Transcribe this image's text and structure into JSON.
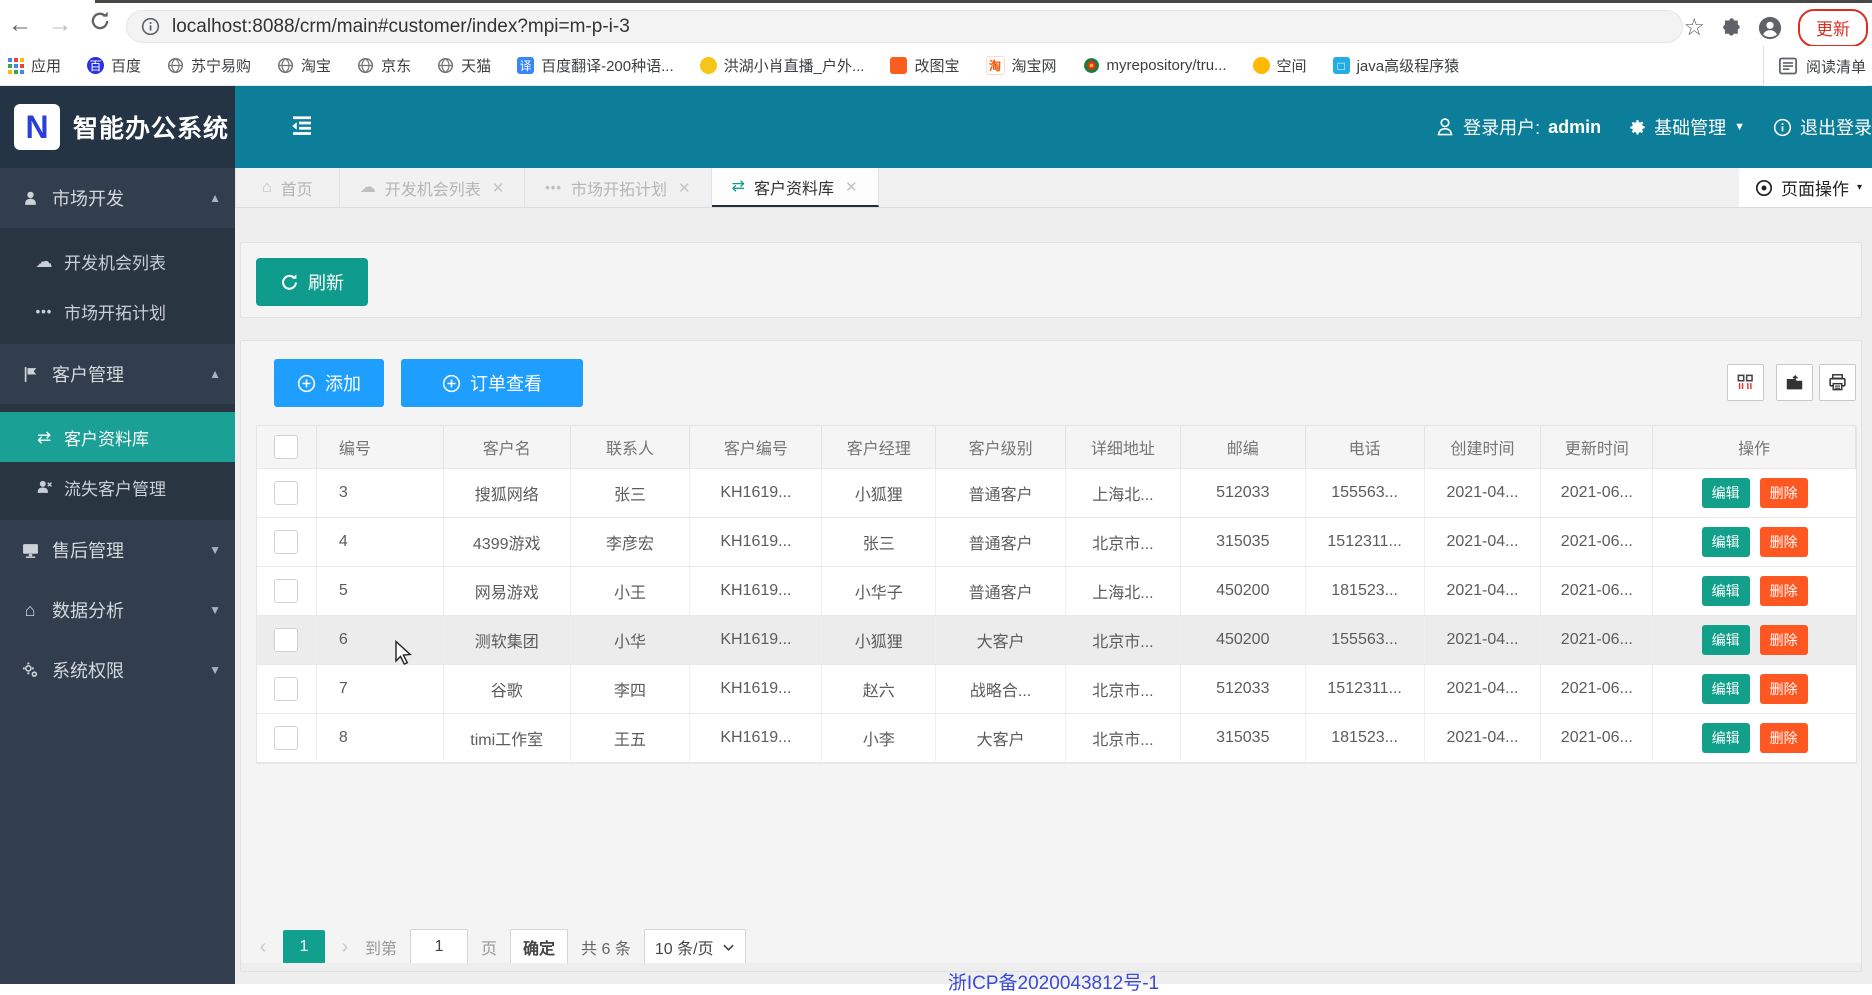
{
  "browser": {
    "url": "localhost:8088/crm/main#customer/index?mpi=m-p-i-3",
    "update_label": "更新",
    "bookmarks": [
      {
        "label": "应用",
        "icon": "apps-grid"
      },
      {
        "label": "百度",
        "icon": "baidu"
      },
      {
        "label": "苏宁易购",
        "icon": "globe"
      },
      {
        "label": "淘宝",
        "icon": "globe"
      },
      {
        "label": "京东",
        "icon": "globe"
      },
      {
        "label": "天猫",
        "icon": "globe"
      },
      {
        "label": "百度翻译-200种语...",
        "icon": "translate"
      },
      {
        "label": "洪湖小肖直播_户外...",
        "icon": "live"
      },
      {
        "label": "改图宝",
        "icon": "gaitubao"
      },
      {
        "label": "淘宝网",
        "icon": "taobao"
      },
      {
        "label": "myrepository/tru...",
        "icon": "repo"
      },
      {
        "label": "空间",
        "icon": "qzone"
      },
      {
        "label": "java高级程序猿",
        "icon": "bilibili"
      }
    ],
    "reading_list_label": "阅读清单"
  },
  "header": {
    "logo_letter": "N",
    "logo_title": "智能办公系统",
    "user_label": "登录用户:",
    "user_name": "admin",
    "base_mgmt_label": "基础管理",
    "logout_label": "退出登录"
  },
  "sidebar": {
    "groups": [
      {
        "label": "市场开发",
        "icon": "person",
        "expanded": true,
        "items": [
          {
            "label": "开发机会列表",
            "icon": "cloud"
          },
          {
            "label": "市场开拓计划",
            "icon": "dots"
          }
        ]
      },
      {
        "label": "客户管理",
        "icon": "flag",
        "expanded": true,
        "items": [
          {
            "label": "客户资料库",
            "icon": "exchange",
            "active": true
          },
          {
            "label": "流失客户管理",
            "icon": "user-x"
          }
        ]
      },
      {
        "label": "售后管理",
        "icon": "monitor",
        "expanded": false,
        "items": []
      },
      {
        "label": "数据分析",
        "icon": "home",
        "expanded": false,
        "items": []
      },
      {
        "label": "系统权限",
        "icon": "gears",
        "expanded": false,
        "items": []
      }
    ]
  },
  "tabs": [
    {
      "label": "首页",
      "icon": "home",
      "closable": false,
      "active": false
    },
    {
      "label": "开发机会列表",
      "icon": "cloud",
      "closable": true,
      "active": false
    },
    {
      "label": "市场开拓计划",
      "icon": "dots",
      "closable": true,
      "active": false
    },
    {
      "label": "客户资料库",
      "icon": "exchange",
      "closable": true,
      "active": true
    }
  ],
  "page_ops_label": "页面操作",
  "toolbar": {
    "refresh_label": "刷新",
    "add_label": "添加",
    "order_view_label": "订单查看",
    "icon_buttons": [
      "filter-columns",
      "export",
      "print"
    ]
  },
  "table": {
    "columns": [
      "编号",
      "客户名",
      "联系人",
      "客户编号",
      "客户经理",
      "客户级别",
      "详细地址",
      "邮编",
      "电话",
      "创建时间",
      "更新时间",
      "操作"
    ],
    "action_labels": {
      "edit": "编辑",
      "delete": "删除"
    },
    "rows": [
      {
        "cells": [
          "3",
          "搜狐网络",
          "张三",
          "KH1619...",
          "小狐狸",
          "普通客户",
          "上海北...",
          "512033",
          "155563...",
          "2021-04...",
          "2021-06..."
        ],
        "hover": false
      },
      {
        "cells": [
          "4",
          "4399游戏",
          "李彦宏",
          "KH1619...",
          "张三",
          "普通客户",
          "北京市...",
          "315035",
          "1512311...",
          "2021-04...",
          "2021-06..."
        ],
        "hover": false
      },
      {
        "cells": [
          "5",
          "网易游戏",
          "小王",
          "KH1619...",
          "小华子",
          "普通客户",
          "上海北...",
          "450200",
          "181523...",
          "2021-04...",
          "2021-06..."
        ],
        "hover": false
      },
      {
        "cells": [
          "6",
          "测软集团",
          "小华",
          "KH1619...",
          "小狐狸",
          "大客户",
          "北京市...",
          "450200",
          "155563...",
          "2021-04...",
          "2021-06..."
        ],
        "hover": true
      },
      {
        "cells": [
          "7",
          "谷歌",
          "李四",
          "KH1619...",
          "赵六",
          "战略合...",
          "北京市...",
          "512033",
          "1512311...",
          "2021-04...",
          "2021-06..."
        ],
        "hover": false
      },
      {
        "cells": [
          "8",
          "timi工作室",
          "王五",
          "KH1619...",
          "小李",
          "大客户",
          "北京市...",
          "315035",
          "181523...",
          "2021-04...",
          "2021-06..."
        ],
        "hover": false
      }
    ]
  },
  "pagination": {
    "current_page": "1",
    "goto_label": "到第",
    "page_input_value": "1",
    "page_unit_label": "页",
    "confirm_label": "确定",
    "total_label": "共 6 条",
    "page_size_label": "10 条/页"
  },
  "footer": {
    "icp": "浙ICP备2020043812号-1"
  },
  "colors": {
    "header_teal": "#0d7e99",
    "sidebar_dark": "#323e4d",
    "accent_teal": "#12a08e",
    "button_blue": "#1e9fff",
    "delete_orange": "#ff5722",
    "admin_red": "#ff2b2b"
  }
}
